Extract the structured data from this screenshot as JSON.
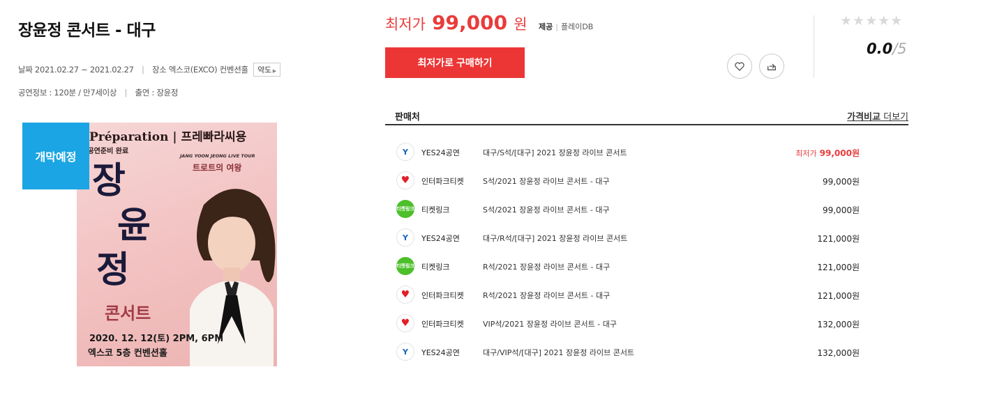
{
  "title": "장윤정 콘서트 - 대구",
  "meta": {
    "date_label": "날짜",
    "date_value": "2021.02.27 ~ 2021.02.27",
    "venue_label": "장소",
    "venue_value": "엑스코(EXCO) 컨벤션홀",
    "map_button": "약도",
    "info_label": "공연정보",
    "info_value": "120분 / 만7세이상",
    "cast_label": "출연",
    "cast_value": "장윤정"
  },
  "badge": "개막예정",
  "poster": {
    "title": "Préparation | 프레빠라씨용",
    "subtitle": ": 공연준비 완료",
    "tour": "JANG YOON JEONG LIVE TOUR",
    "tour_sub": "트로트의 여왕",
    "name_chars": [
      "장",
      "윤",
      "정"
    ],
    "concert": "콘서트",
    "date": "2020. 12. 12(토) 2PM, 6PM",
    "place": "엑스코 5층 컨벤션홀"
  },
  "price": {
    "label": "최저가",
    "value": "99,000",
    "unit": "원",
    "provider_label": "제공",
    "provider_value": "플레이DB"
  },
  "buy_button": "최저가로 구매하기",
  "icons": {
    "heart": "heart-icon",
    "share": "share-icon",
    "star": "star-icon"
  },
  "rating": {
    "stars": "★★★★★",
    "score": "0.0",
    "max": "/5",
    "filled_stars": 0
  },
  "sellers": {
    "header_left": "판매처",
    "header_right_bold": "가격비교",
    "header_right": "더보기",
    "lowest_label": "최저가",
    "rows": [
      {
        "logo": "Y",
        "logo_type": "yes",
        "seller": "YES24공연",
        "product": "대구/S석/[대구] 2021 장윤정 라이브 콘서트",
        "price": "99,000원",
        "lowest": true
      },
      {
        "logo": "♥",
        "logo_type": "inter",
        "seller": "인터파크티켓",
        "product": "S석/2021 장윤정 라이브 콘서트 - 대구",
        "price": "99,000원",
        "lowest": false
      },
      {
        "logo": "티켓링크",
        "logo_type": "link",
        "seller": "티켓링크",
        "product": "S석/2021 장윤정 라이브 콘서트 - 대구",
        "price": "99,000원",
        "lowest": false
      },
      {
        "logo": "Y",
        "logo_type": "yes",
        "seller": "YES24공연",
        "product": "대구/R석/[대구] 2021 장윤정 라이브 콘서트",
        "price": "121,000원",
        "lowest": false
      },
      {
        "logo": "티켓링크",
        "logo_type": "link",
        "seller": "티켓링크",
        "product": "R석/2021 장윤정 라이브 콘서트 - 대구",
        "price": "121,000원",
        "lowest": false
      },
      {
        "logo": "♥",
        "logo_type": "inter",
        "seller": "인터파크티켓",
        "product": "R석/2021 장윤정 라이브 콘서트 - 대구",
        "price": "121,000원",
        "lowest": false
      },
      {
        "logo": "♥",
        "logo_type": "inter",
        "seller": "인터파크티켓",
        "product": "VIP석/2021 장윤정 라이브 콘서트 - 대구",
        "price": "132,000원",
        "lowest": false
      },
      {
        "logo": "Y",
        "logo_type": "yes",
        "seller": "YES24공연",
        "product": "대구/VIP석/[대구] 2021 장윤정 라이브 콘서트",
        "price": "132,000원",
        "lowest": false
      }
    ]
  }
}
